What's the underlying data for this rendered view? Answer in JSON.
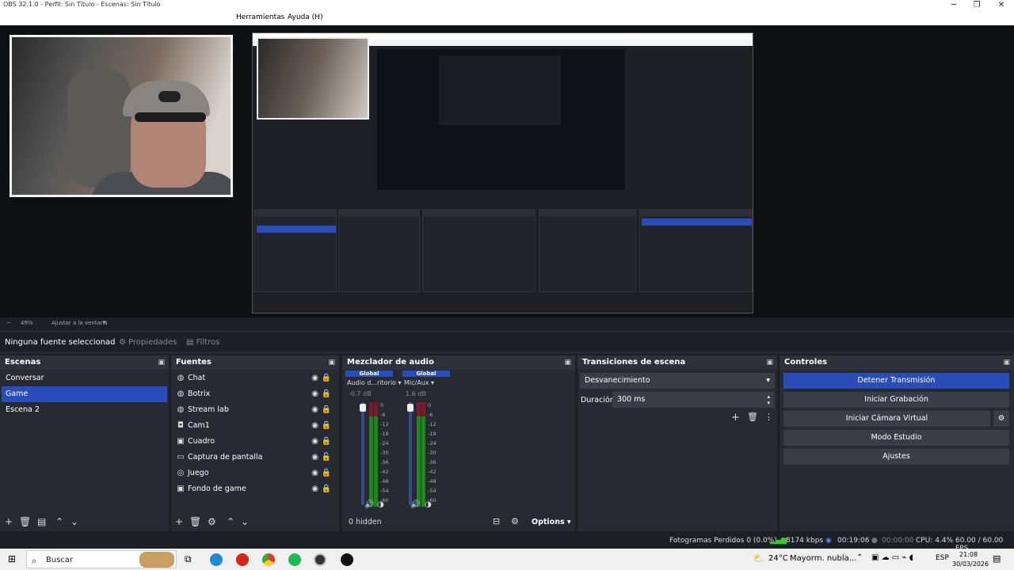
{
  "window": {
    "title": "OBS 32.1.0 - Perfil: Sin Título - Escenas: Sin Título",
    "controls": [
      "─",
      "❐",
      "✕"
    ]
  },
  "menu": {
    "items": [
      "Herramientas",
      "Ayuda (H)"
    ]
  },
  "preview": {
    "zoom": "49%",
    "fit": "Ajustar a la ventana"
  },
  "sourcebar": {
    "label": "Ninguna fuente seleccionad",
    "properties": "Propiedades",
    "filters": "Filtros"
  },
  "scenes": {
    "title": "Escenas",
    "items": [
      "Conversar",
      "Game",
      "Escena 2"
    ],
    "selected": "Game"
  },
  "sources": {
    "title": "Fuentes",
    "items": [
      {
        "name": "Chat",
        "icon": "globe-icon"
      },
      {
        "name": "Botrix",
        "icon": "globe-icon"
      },
      {
        "name": "Stream lab",
        "icon": "globe-icon"
      },
      {
        "name": "Cam1",
        "icon": "camera-icon"
      },
      {
        "name": "Cuadro",
        "icon": "image-icon"
      },
      {
        "name": "Captura de pantalla",
        "icon": "monitor-icon"
      },
      {
        "name": "Juego",
        "icon": "gamepad-icon"
      },
      {
        "name": "Fondo de game",
        "icon": "image-icon"
      }
    ]
  },
  "mixer": {
    "title": "Mezclador de audio",
    "channels": [
      {
        "global": "Global",
        "name": "Audio d...ritorio",
        "db": "-0.7 dB"
      },
      {
        "global": "Global",
        "name": "Mic/Aux",
        "db": "1.6 dB"
      }
    ],
    "scale": [
      "0",
      "-6",
      "-12",
      "-18",
      "-24",
      "-30",
      "-36",
      "-42",
      "-48",
      "-54",
      "-60"
    ],
    "hidden": "0 hidden",
    "options": "Options"
  },
  "transitions": {
    "title": "Transiciones de escena",
    "selected": "Desvanecimiento",
    "duration_label": "Duración",
    "duration_value": "300 ms"
  },
  "controls": {
    "title": "Controles",
    "stop_stream": "Detener Transmisión",
    "start_record": "Iniciar Grabación",
    "virtual_cam": "Iniciar Cámara Virtual",
    "studio_mode": "Modo Estudio",
    "settings": "Ajustes"
  },
  "status": {
    "dropped": "Fotogramas Perdidos 0 (0.0%)",
    "bitrate": "8174 kbps",
    "stream_time": "00:19:06",
    "record_time": "00:00:00",
    "cpu": "CPU: 4.4%",
    "fps": "60.00 / 60.00 FPS"
  },
  "taskbar": {
    "search": "Buscar",
    "weather": "24°C",
    "weather_desc": "Mayorm. nubla...",
    "lang": "ESP",
    "time": "21:08",
    "date": "30/03/2026"
  },
  "colors": {
    "accent": "#284cb8",
    "background": "#1d1f26",
    "dock": "#272a33",
    "meter_green": "#1a8a1a"
  }
}
